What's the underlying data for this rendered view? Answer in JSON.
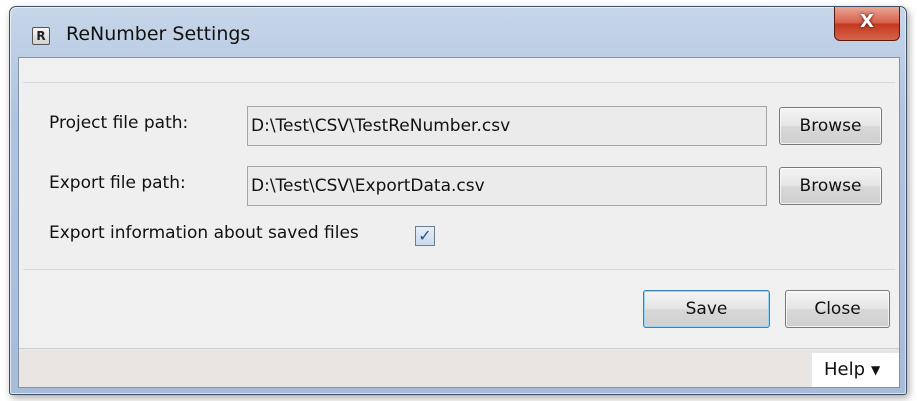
{
  "window": {
    "title": "ReNumber Settings",
    "app_icon_letter": "R",
    "close_glyph": "X"
  },
  "form": {
    "project_label": "Project file path:",
    "project_value": "D:\\Test\\CSV\\TestReNumber.csv",
    "export_label": "Export file path:",
    "export_value": "D:\\Test\\CSV\\ExportData.csv",
    "browse_label": "Browse",
    "export_info_label": "Export information about saved files",
    "export_info_checked": true
  },
  "actions": {
    "save_label": "Save",
    "close_label": "Close"
  },
  "footer": {
    "help_label": "Help"
  },
  "icons": {
    "app": "app-icon",
    "close": "close-icon",
    "check": "check-icon",
    "help_dropdown": "chevron-down-icon"
  }
}
